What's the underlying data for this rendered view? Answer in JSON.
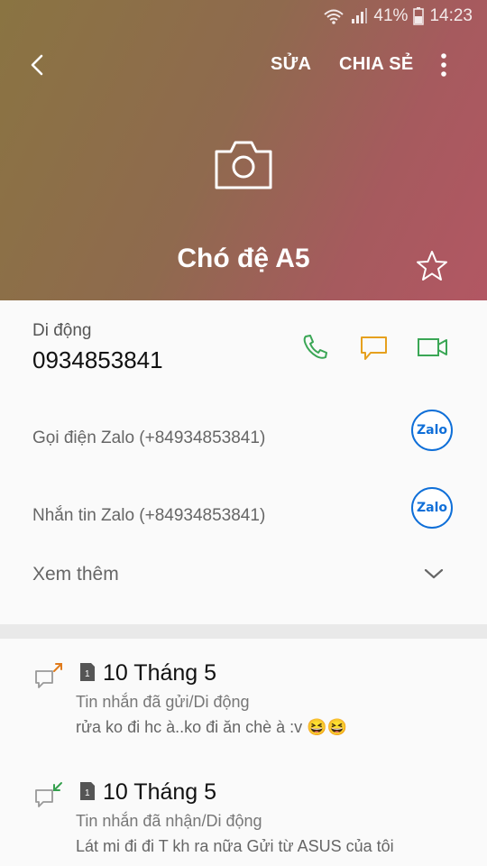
{
  "status_bar": {
    "battery": "41%",
    "time": "14:23"
  },
  "toolbar": {
    "edit_label": "SỬA",
    "share_label": "CHIA SẺ"
  },
  "contact": {
    "name": "Chó đệ A5",
    "phone_label": "Di động",
    "phone_number": "0934853841",
    "zalo_call": "Gọi điện Zalo (+84934853841)",
    "zalo_message": "Nhắn tin Zalo (+84934853841)",
    "zalo_logo_text": "Zalo",
    "see_more": "Xem thêm"
  },
  "log": [
    {
      "date": "10 Tháng 5",
      "type": "Tin nhắn đã gửi/Di động",
      "text": "rửa ko đi hc à..ko đi ăn chè à :v 😆😆",
      "direction": "outgoing"
    },
    {
      "date": "10 Tháng 5",
      "type": "Tin nhắn đã nhận/Di động",
      "text": "Lát mi đi đi T kh ra nữa  Gửi từ ASUS của tôi",
      "direction": "incoming"
    }
  ],
  "colors": {
    "call_green": "#3aa655",
    "message_orange": "#e6a01e",
    "zalo_blue": "#0f6fd8",
    "outgoing_arrow": "#e07b1c",
    "incoming_arrow": "#35a04e"
  },
  "icons": [
    "wifi-icon",
    "signal-icon",
    "battery-icon",
    "back-arrow-icon",
    "more-vert-icon",
    "camera-icon",
    "star-icon",
    "phone-icon",
    "message-icon",
    "video-call-icon",
    "chevron-down-icon",
    "sim-card-icon"
  ]
}
